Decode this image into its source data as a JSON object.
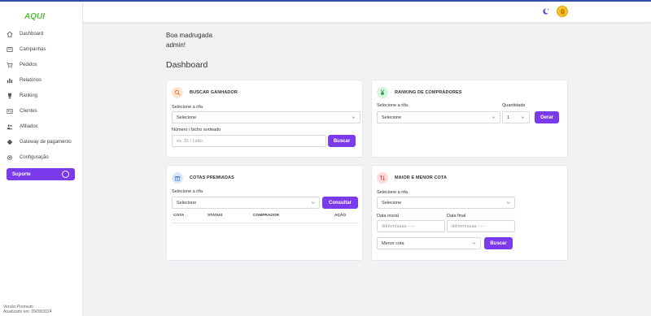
{
  "app": {
    "logo": "AQUI"
  },
  "sidebar": {
    "items": [
      {
        "label": "Dashboard",
        "icon": "home-icon"
      },
      {
        "label": "Campanhas",
        "icon": "campaign-icon"
      },
      {
        "label": "Pedidos",
        "icon": "cart-icon"
      },
      {
        "label": "Relatórios",
        "icon": "bar-chart-icon"
      },
      {
        "label": "Ranking",
        "icon": "trophy-icon"
      },
      {
        "label": "Clientes",
        "icon": "id-card-icon"
      },
      {
        "label": "Afiliados",
        "icon": "users-icon"
      },
      {
        "label": "Gateway de pagamento",
        "icon": "diamond-icon"
      },
      {
        "label": "Configuração",
        "icon": "gear-icon"
      }
    ],
    "support_label": "Suporte",
    "version_line1": "Versão Premium",
    "version_line2": "Atualizado em: 09/08/2024"
  },
  "main": {
    "greeting_line1": "Boa madrugada",
    "greeting_line2": "admin!",
    "title": "Dashboard"
  },
  "buscar_ganhador": {
    "title": "BUSCAR GANHADOR",
    "rifa_label": "Selecione a rifa",
    "rifa_value": "Selecione",
    "numero_label": "Número / bicho sorteado",
    "numero_placeholder": "ex. 15 / Leão",
    "button": "Buscar"
  },
  "ranking": {
    "title": "RANKING DE COMPRADORES",
    "rifa_label": "Selecione a rifa",
    "rifa_value": "Selecione",
    "quantidade_label": "Quantidade",
    "quantidade_value": "1",
    "button": "Gerar"
  },
  "cotas_premiadas": {
    "title": "COTAS PREMIADAS",
    "rifa_label": "Selecione a rifa",
    "rifa_value": "Selecione",
    "button": "Consultar",
    "columns": [
      "COTA",
      "STATUS",
      "COMPRADOR",
      "AÇÃO"
    ]
  },
  "maior_menor": {
    "title": "MAIOR E MENOR COTA",
    "rifa_label": "Selecione a rifa",
    "rifa_value": "Selecione",
    "data_inicial_label": "Data inicial",
    "data_final_label": "Data final",
    "date_placeholder": "dd/mm/aaaa --:--",
    "tipo_value": "Menor cota",
    "button": "Buscar"
  },
  "colors": {
    "accent": "#7c3aed",
    "logo": "#5bbf3a",
    "topbar": "#2f4fa8"
  }
}
